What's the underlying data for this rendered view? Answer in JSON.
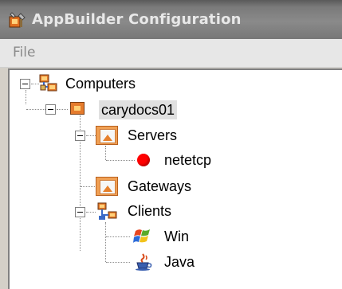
{
  "window": {
    "title": "AppBuilder Configuration",
    "app_icon": "appbuilder-icon"
  },
  "menu": {
    "items": [
      "File"
    ]
  },
  "tree": {
    "nodes": {
      "computers": {
        "label": "Computers",
        "icon": "network-computers-icon",
        "expanded": true
      },
      "carydocs01": {
        "label": "carydocs01",
        "icon": "monitor-icon",
        "expanded": true,
        "selected": true
      },
      "servers": {
        "label": "Servers",
        "icon": "servers-icon",
        "expanded": true
      },
      "netetcp": {
        "label": "netetcp",
        "icon": "red-status-dot-icon"
      },
      "gateways": {
        "label": "Gateways",
        "icon": "gateways-icon"
      },
      "clients": {
        "label": "Clients",
        "icon": "clients-network-icon",
        "expanded": true
      },
      "win": {
        "label": "Win",
        "icon": "windows-logo-icon"
      },
      "java": {
        "label": "Java",
        "icon": "java-cup-icon"
      }
    }
  },
  "colors": {
    "titlebar": "#7a7a7a",
    "menubar": "#e7e7e7",
    "tree_background": "#ffffff",
    "selection": "#e0e0e0",
    "node_icon_orange": "#f0a054",
    "status_red": "#ff0000"
  }
}
